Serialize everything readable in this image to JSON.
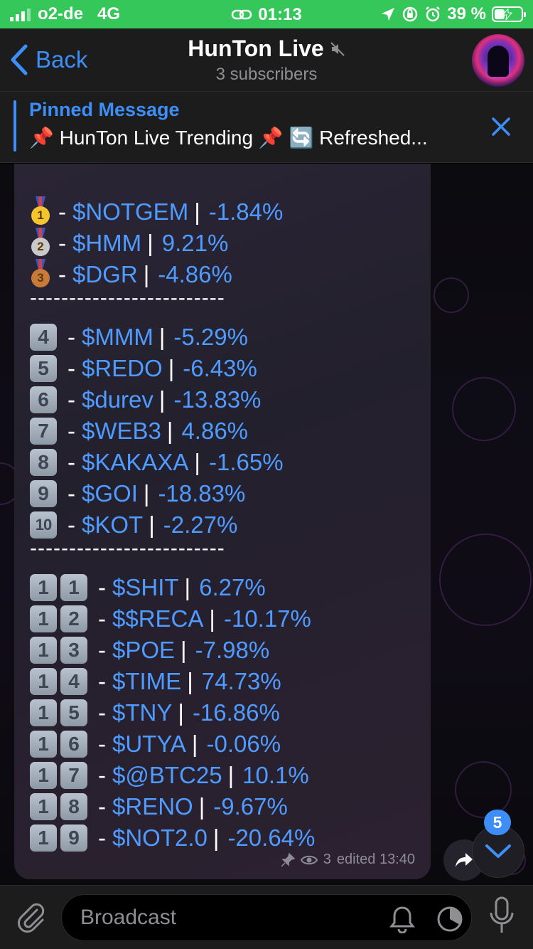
{
  "status_bar": {
    "carrier": "o2-de",
    "network": "4G",
    "time": "01:13",
    "battery": "39 %",
    "battery_level": 0.39
  },
  "header": {
    "back_label": "Back",
    "title": "HunTon Live",
    "subtitle": "3 subscribers"
  },
  "pinned": {
    "title": "Pinned Message",
    "text": "📌 HunTon Live Trending 📌 🔄 Refreshed..."
  },
  "message": {
    "separator": "-------------------------",
    "top3": [
      {
        "rank": "1",
        "medal_color": "#f5c530",
        "ticker": "$NOTGEM",
        "change": "-1.84%"
      },
      {
        "rank": "2",
        "medal_color": "#c9c9c9",
        "ticker": "$HMM",
        "change": "9.21%"
      },
      {
        "rank": "3",
        "medal_color": "#c97a3a",
        "ticker": "$DGR",
        "change": "-4.86%"
      }
    ],
    "mid": [
      {
        "rank": "4",
        "ticker": "$MMM",
        "change": "-5.29%"
      },
      {
        "rank": "5",
        "ticker": "$REDO",
        "change": "-6.43%"
      },
      {
        "rank": "6",
        "ticker": "$durev",
        "change": "-13.83%"
      },
      {
        "rank": "7",
        "ticker": "$WEB3",
        "change": "4.86%"
      },
      {
        "rank": "8",
        "ticker": "$KAKAXA",
        "change": "-1.65%"
      },
      {
        "rank": "9",
        "ticker": "$GOI",
        "change": "-18.83%"
      },
      {
        "rank": "10",
        "ticker": "$KOT",
        "change": "-2.27%"
      }
    ],
    "rest": [
      {
        "d1": "1",
        "d2": "1",
        "ticker": "$SHIT",
        "change": "6.27%"
      },
      {
        "d1": "1",
        "d2": "2",
        "ticker": "$$RECA",
        "change": "-10.17%"
      },
      {
        "d1": "1",
        "d2": "3",
        "ticker": "$POE",
        "change": "-7.98%"
      },
      {
        "d1": "1",
        "d2": "4",
        "ticker": "$TIME",
        "change": "74.73%"
      },
      {
        "d1": "1",
        "d2": "5",
        "ticker": "$TNY",
        "change": "-16.86%"
      },
      {
        "d1": "1",
        "d2": "6",
        "ticker": "$UTYA",
        "change": "-0.06%"
      },
      {
        "d1": "1",
        "d2": "7",
        "ticker": "$@BTC25",
        "change": "10.1%"
      },
      {
        "d1": "1",
        "d2": "8",
        "ticker": "$RENO",
        "change": "-9.67%"
      },
      {
        "d1": "1",
        "d2": "9",
        "ticker": "$NOT2.0",
        "change": "-20.64%"
      }
    ],
    "views": "3",
    "edited_time": "edited 13:40"
  },
  "scroll_badge": "5",
  "composer": {
    "placeholder": "Broadcast"
  },
  "colors": {
    "accent": "#3e8ef7",
    "status_green": "#35c759",
    "ticker_blue": "#4f9bff"
  }
}
